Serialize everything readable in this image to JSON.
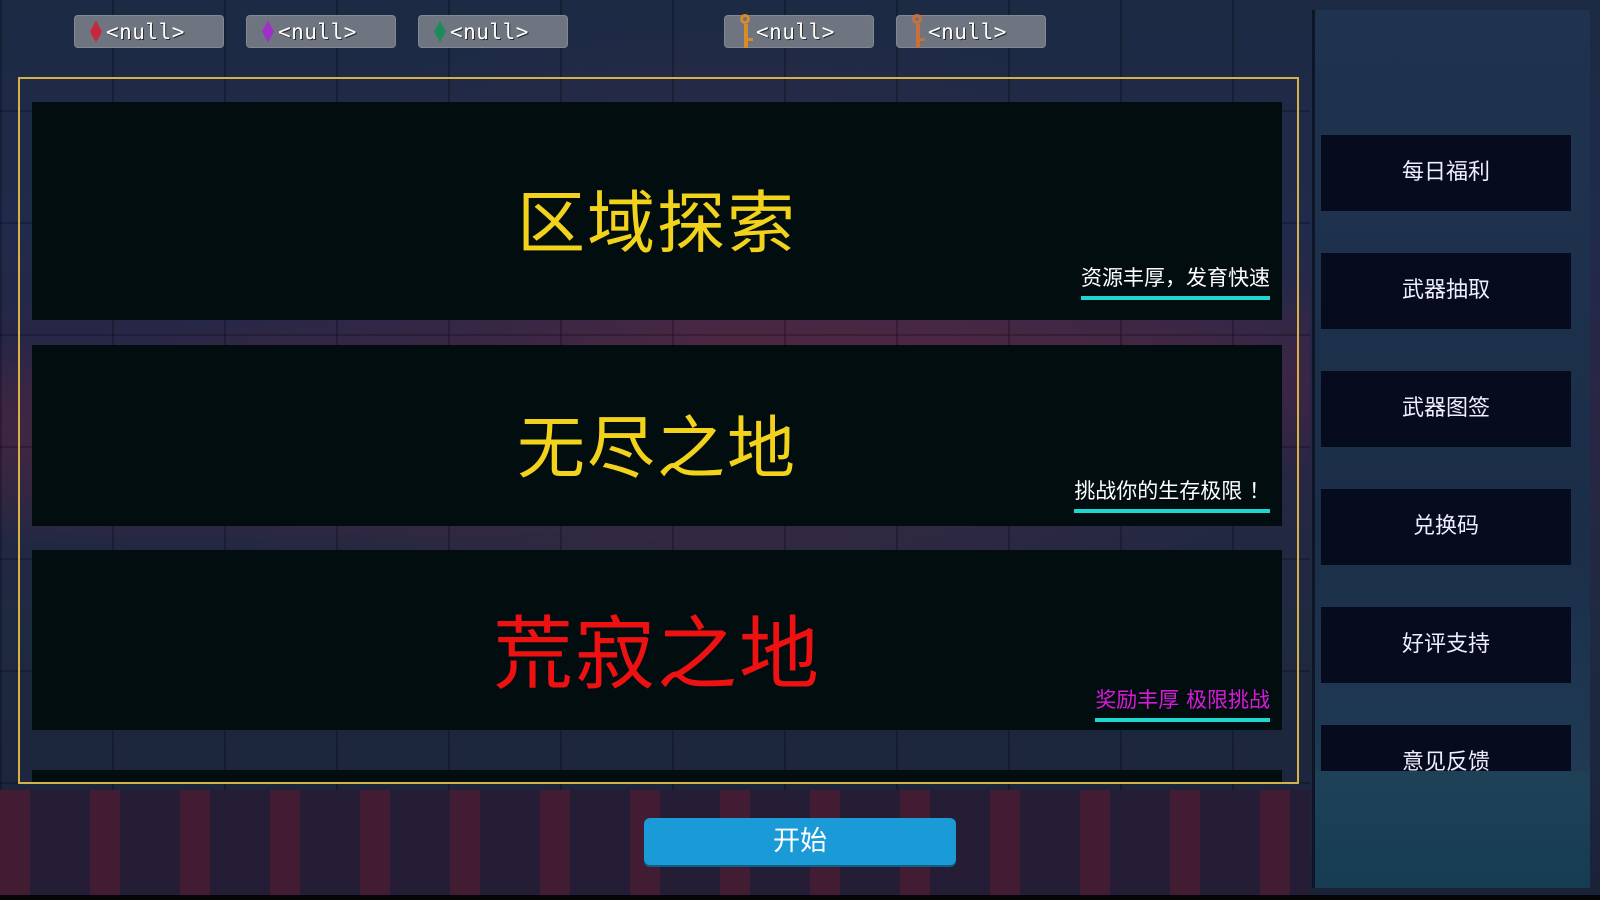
{
  "resources": [
    {
      "icon": "red-gem-icon",
      "value": "<null>",
      "color": "#c8283c"
    },
    {
      "icon": "purple-gem-icon",
      "value": "<null>",
      "color": "#a030c8"
    },
    {
      "icon": "green-gem-icon",
      "value": "<null>",
      "color": "#1f8a5a"
    },
    {
      "icon": "gold-key-icon",
      "value": "<null>",
      "color": "#d98a2a"
    },
    {
      "icon": "copper-key-icon",
      "value": "<null>",
      "color": "#c8703a"
    }
  ],
  "modes": [
    {
      "title": "区域探索",
      "subtitle": "资源丰厚，发育快速",
      "title_color": "#f2d21a",
      "subtitle_color": "#ffffff"
    },
    {
      "title": "无尽之地",
      "subtitle": "挑战你的生存极限 ！",
      "title_color": "#f2d21a",
      "subtitle_color": "#ffffff"
    },
    {
      "title": "荒寂之地",
      "subtitle": "奖励丰厚 极限挑战",
      "title_color": "#ee1111",
      "subtitle_color": "#d81bd8"
    }
  ],
  "start_button": "开始",
  "sidebar": {
    "items": [
      "每日福利",
      "武器抽取",
      "武器图签",
      "兑换码",
      "好评支持",
      "意见反馈"
    ]
  },
  "colors": {
    "panel_border": "#d8b04a",
    "underline": "#1fd6d0",
    "start_button": "#1a9bd8",
    "sidebar_button": "#060b1e"
  }
}
